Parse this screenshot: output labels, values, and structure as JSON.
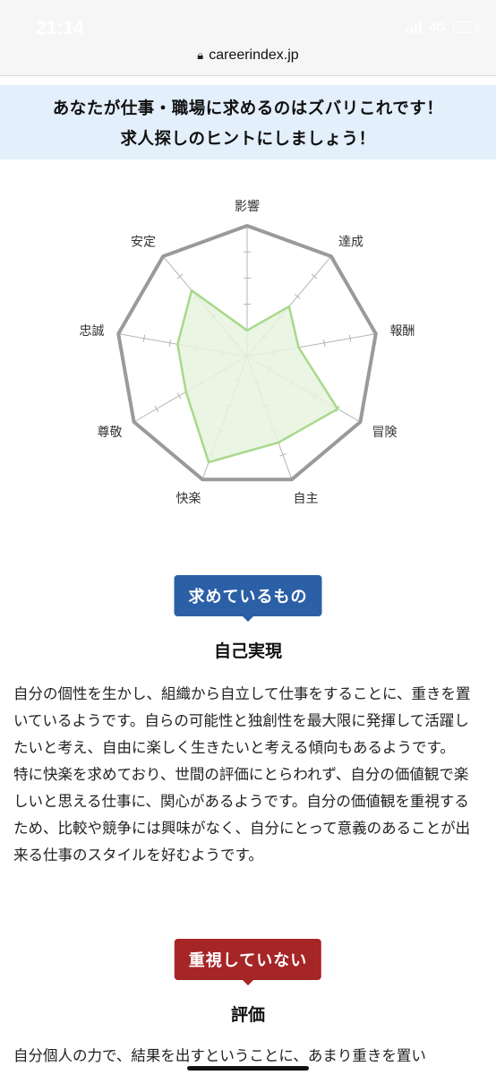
{
  "status_bar": {
    "time": "21:14",
    "network": "4G"
  },
  "browser": {
    "url": "careerindex.jp",
    "lock_icon": "lock-icon"
  },
  "banner": {
    "line1": "あなたが仕事・職場に求めるのはズバリこれです！",
    "line2": "求人探しのヒントにしましょう！"
  },
  "chart_data": {
    "type": "radar",
    "axes": [
      "影響",
      "達成",
      "報酬",
      "冒険",
      "自主",
      "快楽",
      "尊敬",
      "忠誠",
      "安定"
    ],
    "scale_max": 5,
    "values": [
      1,
      2.5,
      2,
      4,
      3.5,
      4.3,
      2.7,
      2.7,
      3.3
    ],
    "fill_color": "#e6f3df",
    "line_color": "#a8d98a",
    "grid_color": "#999999"
  },
  "wanted": {
    "label": "求めているもの",
    "title": "自己実現",
    "paragraphs": [
      "自分の個性を生かし、組織から自立して仕事をすることに、重きを置いているようです。自らの可能性と独創性を最大限に発揮して活躍したいと考え、自由に楽しく生きたいと考える傾向もあるようです。",
      "特に快楽を求めており、世間の評価にとらわれず、自分の価値観で楽しいと思える仕事に、関心があるようです。自分の価値観を重視するため、比較や競争には興味がなく、自分にとって意義のあることが出来る仕事のスタイルを好むようです。"
    ]
  },
  "not_valued": {
    "label": "重視していない",
    "title": "評価",
    "text": "自分個人の力で、結果を出すということに、あまり重きを置い"
  },
  "colors": {
    "blue": "#2b5fa6",
    "red": "#a62527",
    "banner_bg": "#e3effb"
  }
}
